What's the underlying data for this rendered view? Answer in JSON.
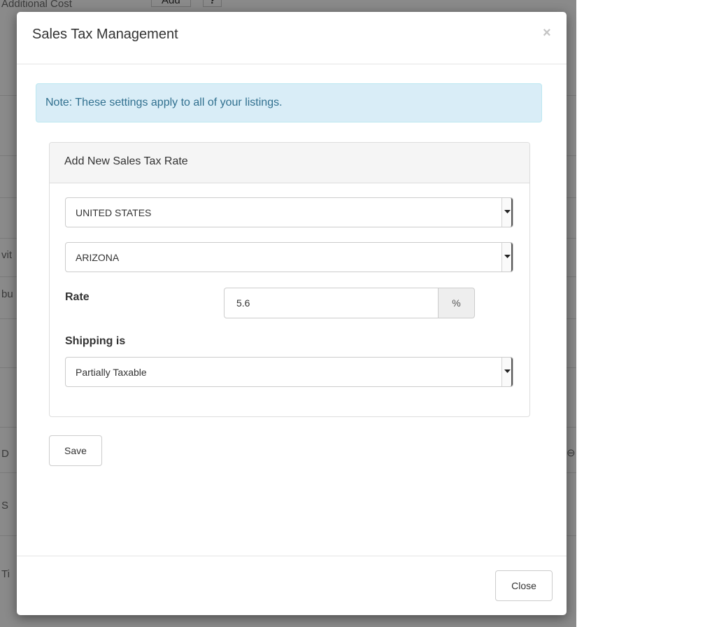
{
  "background": {
    "top_label": "Additional Cost",
    "top_add_button": "Add",
    "top_help_button": "?",
    "left_fragments": [
      "vit",
      "bu",
      "D",
      "S",
      "Ti"
    ],
    "right_fragment": "⊖"
  },
  "modal": {
    "title": "Sales Tax Management",
    "close_symbol": "×",
    "note": "Note: These settings apply to all of your listings.",
    "panel": {
      "title": "Add New Sales Tax Rate",
      "country": "UNITED STATES",
      "state": "ARIZONA",
      "rate_label": "Rate",
      "rate_value": "5.6",
      "rate_unit": "%",
      "shipping_label": "Shipping is",
      "shipping_value": "Partially Taxable"
    },
    "save_label": "Save",
    "close_label": "Close"
  }
}
